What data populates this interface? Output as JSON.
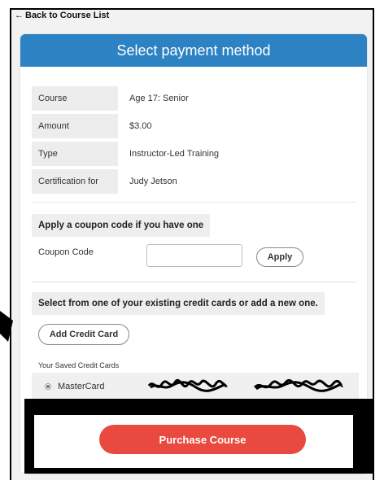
{
  "nav": {
    "back_label": "Back to Course List"
  },
  "panel": {
    "title": "Select payment method"
  },
  "details": [
    {
      "label": "Course",
      "value": "Age 17: Senior"
    },
    {
      "label": "Amount",
      "value": "$3.00"
    },
    {
      "label": "Type",
      "value": "Instructor-Led Training"
    },
    {
      "label": "Certification for",
      "value": "Judy Jetson"
    }
  ],
  "coupon": {
    "section_title": "Apply a coupon code if you have one",
    "label": "Coupon Code",
    "value": "",
    "placeholder": "",
    "apply_label": "Apply"
  },
  "cards": {
    "section_title": "Select from one of your existing credit cards or add a new one.",
    "add_label": "Add Credit Card",
    "saved_label": "Your Saved Credit Cards",
    "items": [
      {
        "name": "MasterCard",
        "selected": true
      }
    ]
  },
  "purchase": {
    "label": "Purchase Course"
  },
  "colors": {
    "header": "#2d82c3",
    "purchase": "#e84a3f"
  }
}
